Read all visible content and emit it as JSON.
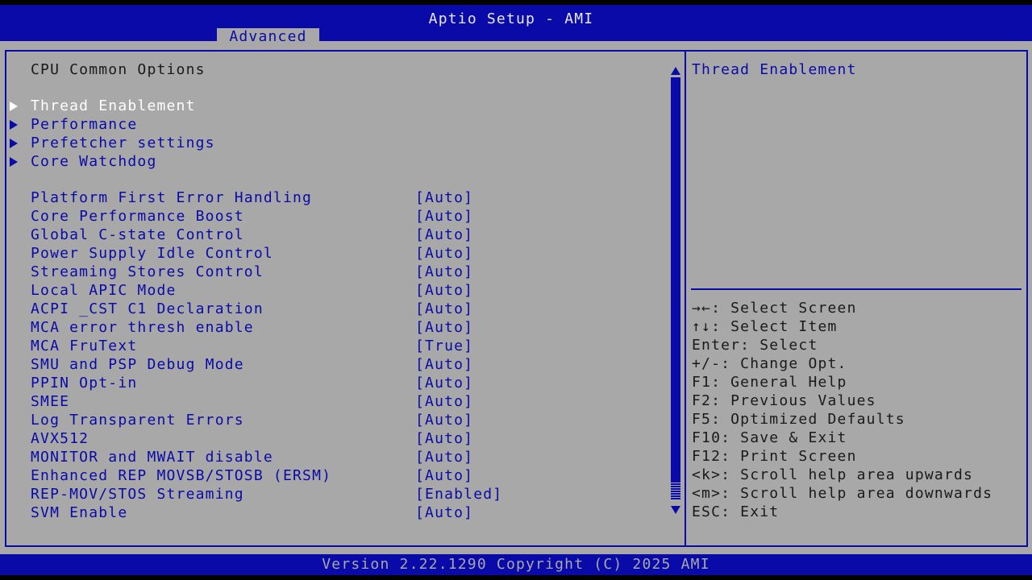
{
  "header": {
    "title": "Aptio Setup - AMI",
    "active_tab": "Advanced"
  },
  "page": {
    "section_title": "CPU Common Options"
  },
  "submenus": [
    {
      "label": "Thread Enablement",
      "selected": true
    },
    {
      "label": "Performance",
      "selected": false
    },
    {
      "label": "Prefetcher settings",
      "selected": false
    },
    {
      "label": "Core Watchdog",
      "selected": false
    }
  ],
  "settings": [
    {
      "label": "Platform First Error Handling",
      "value": "[Auto]"
    },
    {
      "label": "Core Performance Boost",
      "value": "[Auto]"
    },
    {
      "label": "Global C-state Control",
      "value": "[Auto]"
    },
    {
      "label": "Power Supply Idle Control",
      "value": "[Auto]"
    },
    {
      "label": "Streaming Stores Control",
      "value": "[Auto]"
    },
    {
      "label": "Local APIC Mode",
      "value": "[Auto]"
    },
    {
      "label": "ACPI _CST C1 Declaration",
      "value": "[Auto]"
    },
    {
      "label": "MCA error thresh enable",
      "value": "[Auto]"
    },
    {
      "label": "MCA FruText",
      "value": "[True]"
    },
    {
      "label": "SMU and PSP Debug Mode",
      "value": "[Auto]"
    },
    {
      "label": "PPIN Opt-in",
      "value": "[Auto]"
    },
    {
      "label": "SMEE",
      "value": "[Auto]"
    },
    {
      "label": "Log Transparent Errors",
      "value": "[Auto]"
    },
    {
      "label": "AVX512",
      "value": "[Auto]"
    },
    {
      "label": "MONITOR and MWAIT disable",
      "value": "[Auto]"
    },
    {
      "label": "Enhanced REP MOVSB/STOSB (ERSM)",
      "value": "[Auto]"
    },
    {
      "label": "REP-MOV/STOS Streaming",
      "value": "[Enabled]"
    },
    {
      "label": "SVM Enable",
      "value": "[Auto]"
    }
  ],
  "help": {
    "description": "Thread Enablement",
    "keys": [
      "→←: Select Screen",
      "↑↓: Select Item",
      "Enter: Select",
      "+/-: Change Opt.",
      "F1: General Help",
      "F2: Previous Values",
      "F5: Optimized Defaults",
      "F10: Save & Exit",
      "F12: Print Screen",
      "<k>: Scroll help area upwards",
      "<m>: Scroll help area downwards",
      "ESC: Exit"
    ]
  },
  "footer": {
    "version": "Version 2.22.1290 Copyright (C) 2025 AMI"
  },
  "colors": {
    "bios_blue": "#0a0aa8",
    "panel_gray": "#a8a8a8",
    "selected_text": "#ffffff"
  }
}
